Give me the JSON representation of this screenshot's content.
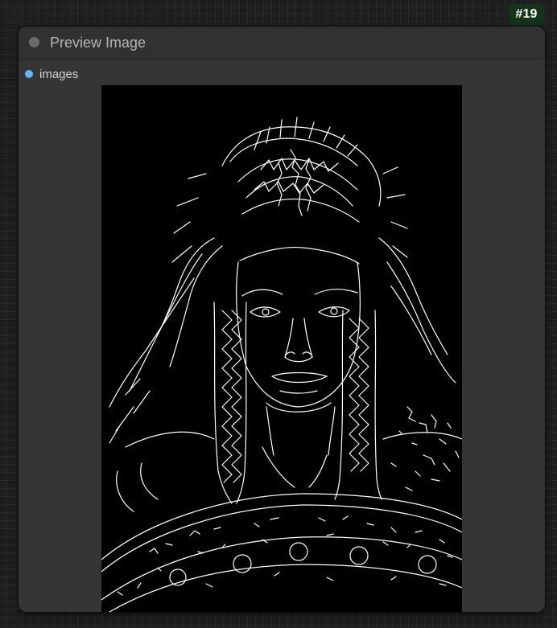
{
  "badge": {
    "label": "#19"
  },
  "node": {
    "title": "Preview Image",
    "inputs": [
      {
        "label": "images",
        "color": "#64b5f6"
      }
    ]
  },
  "preview": {
    "image": "canny-edge-preview-image",
    "background": "#000000",
    "line_color": "#ffffff"
  }
}
